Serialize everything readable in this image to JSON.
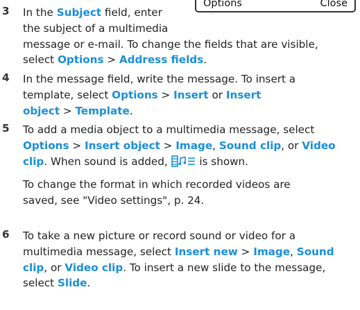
{
  "softkeys": {
    "left": "Options",
    "right": "Close"
  },
  "steps": [
    {
      "num": "3",
      "parts": [
        {
          "t": "In the "
        },
        {
          "t": "Subject",
          "b": 1
        },
        {
          "t": " field, enter\nthe subject of a multimedia\nmessage or e-mail. To change the fields that are visible,\nselect "
        },
        {
          "t": "Options",
          "b": 1
        },
        {
          "t": " > "
        },
        {
          "t": "Address fields",
          "b": 1
        },
        {
          "t": "."
        }
      ]
    },
    {
      "num": "4",
      "parts": [
        {
          "t": "In the message field, write the message. To insert a\ntemplate, select "
        },
        {
          "t": "Options",
          "b": 1
        },
        {
          "t": " > "
        },
        {
          "t": "Insert",
          "b": 1
        },
        {
          "t": " or "
        },
        {
          "t": "Insert\nobject",
          "b": 1
        },
        {
          "t": " > "
        },
        {
          "t": "Template",
          "b": 1
        },
        {
          "t": "."
        }
      ]
    },
    {
      "num": "5",
      "parts": [
        {
          "t": "To add a media object to a multimedia message, select\n"
        },
        {
          "t": "Options",
          "b": 1
        },
        {
          "t": " > "
        },
        {
          "t": "Insert object",
          "b": 1
        },
        {
          "t": " > "
        },
        {
          "t": "Image",
          "b": 1
        },
        {
          "t": ", "
        },
        {
          "t": "Sound clip",
          "b": 1
        },
        {
          "t": ", or "
        },
        {
          "t": "Video\nclip",
          "b": 1
        },
        {
          "t": ". When sound is added, "
        },
        {
          "icon": "media-clip-icon"
        },
        {
          "t": " is shown."
        }
      ],
      "sub": "To change the format in which recorded videos are\nsaved, see \"Video settings\", p. 24."
    },
    {
      "num": "6",
      "parts": [
        {
          "t": "To take a new picture or record sound or video for a\nmultimedia message, select "
        },
        {
          "t": "Insert new",
          "b": 1
        },
        {
          "t": " > "
        },
        {
          "t": "Image",
          "b": 1
        },
        {
          "t": ", "
        },
        {
          "t": "Sound\nclip",
          "b": 1
        },
        {
          "t": ", or "
        },
        {
          "t": "Video clip",
          "b": 1
        },
        {
          "t": ". To insert a new slide to the message,\nselect "
        },
        {
          "t": "Slide",
          "b": 1
        },
        {
          "t": "."
        }
      ]
    }
  ]
}
